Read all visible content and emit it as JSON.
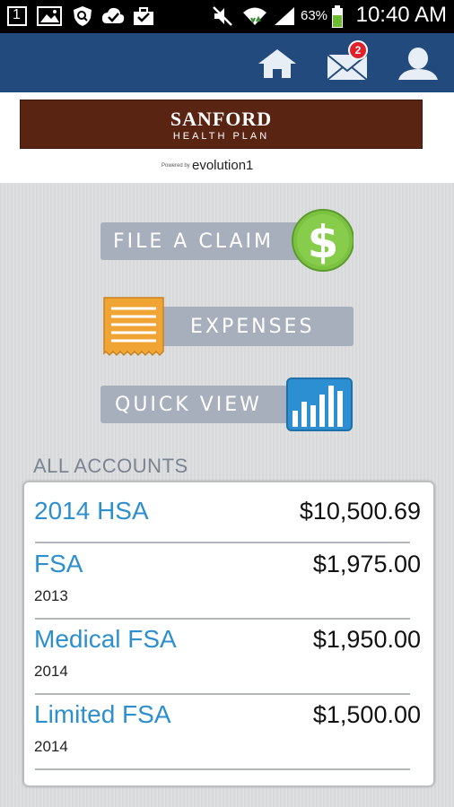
{
  "status_bar": {
    "notification_count": "1",
    "battery": "63%",
    "time": "10:40 AM",
    "icons": [
      "notification-count-icon",
      "image-icon",
      "shield-icon",
      "check-icon",
      "briefcase-icon",
      "mute-icon",
      "wifi-icon",
      "signal-icon",
      "battery-icon"
    ]
  },
  "header": {
    "home_icon": "home-icon",
    "mail_icon": "mail-icon",
    "mail_badge": "2",
    "profile_icon": "profile-icon",
    "bar_color": "#234a7d"
  },
  "logo": {
    "main": "SANFORD",
    "sub": "HEALTH PLAN",
    "powered_by": "Powered by",
    "evolution": "evolution1"
  },
  "actions": {
    "file_claim": "FILE A CLAIM",
    "expenses": "EXPENSES",
    "quick_view": "QUICK VIEW"
  },
  "accounts": {
    "heading": "ALL ACCOUNTS",
    "rows": [
      {
        "name": "2014 HSA",
        "year": "",
        "amount": "$10,500.69"
      },
      {
        "name": "FSA",
        "year": "2013",
        "amount": "$1,975.00"
      },
      {
        "name": "Medical FSA",
        "year": "2014",
        "amount": "$1,950.00"
      },
      {
        "name": "Limited FSA",
        "year": "2014",
        "amount": "$1,500.00"
      }
    ]
  },
  "colors": {
    "accent_blue": "#2d8fce",
    "claim_green": "#7cc241",
    "expenses_orange": "#f0a434",
    "chart_blue": "#2b8fd2",
    "pill_gray": "#a8afbc"
  }
}
